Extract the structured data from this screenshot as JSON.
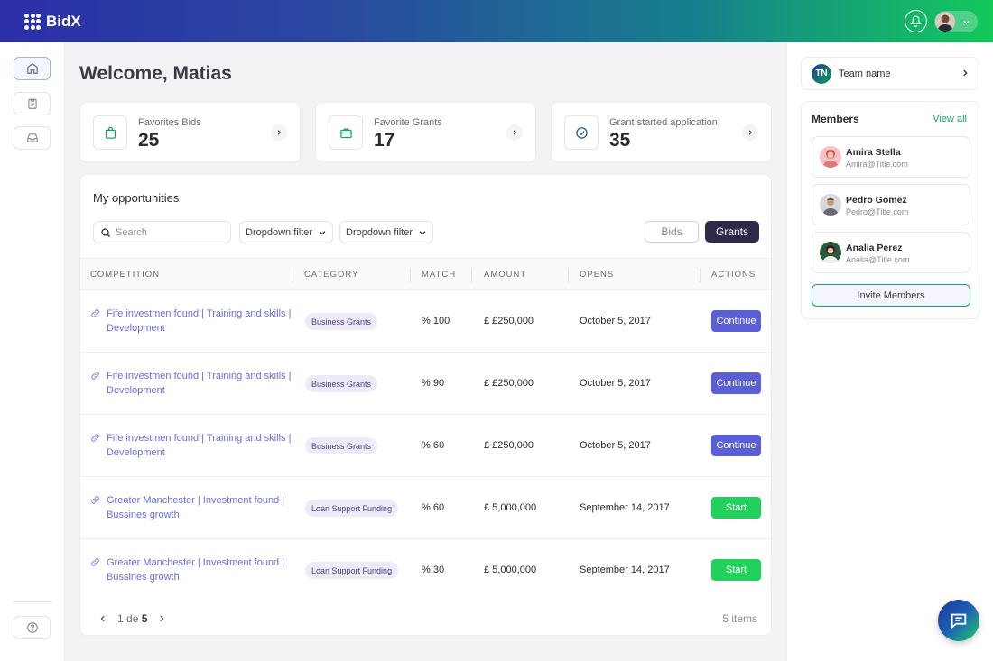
{
  "app": {
    "name": "BidX"
  },
  "welcome": "Welcome, Matias",
  "stats": [
    {
      "label": "Favorites Bids",
      "value": "25",
      "icon": "bag-icon"
    },
    {
      "label": "Favorite Grants",
      "value": "17",
      "icon": "briefcase-icon"
    },
    {
      "label": "Grant started application",
      "value": "35",
      "icon": "check-circle-icon"
    }
  ],
  "opportunities": {
    "title": "My opportunities",
    "search_placeholder": "Search",
    "filters": [
      "Dropdown filter",
      "Dropdown filter"
    ],
    "toggle": {
      "bids": "Bids",
      "grants": "Grants",
      "active": "Grants"
    },
    "columns": [
      "COMPETITION",
      "CATEGORY",
      "MATCH",
      "AMOUNT",
      "OPENS",
      "ACTIONS"
    ],
    "rows": [
      {
        "competition": "Fife investmen found | Training and skills | Development",
        "category": "Business Grants",
        "match": "% 100",
        "amount": "£ £250,000",
        "opens": "October 5, 2017",
        "action": "Continue"
      },
      {
        "competition": "Fife investmen found | Training and skills | Development",
        "category": "Business Grants",
        "match": "% 90",
        "amount": "£ £250,000",
        "opens": "October 5, 2017",
        "action": "Continue"
      },
      {
        "competition": "Fife investmen found | Training and skills | Development",
        "category": "Business Grants",
        "match": "% 60",
        "amount": "£ £250,000",
        "opens": "October 5, 2017",
        "action": "Continue"
      },
      {
        "competition": "Greater Manchester | Investment found | Bussines growth",
        "category": "Loan Support Funding",
        "match": "% 60",
        "amount": "£ 5,000,000",
        "opens": "September 14, 2017",
        "action": "Start"
      },
      {
        "competition": "Greater Manchester | Investment found | Bussines growth",
        "category": "Loan Support Funding",
        "match": "% 30",
        "amount": "£ 5,000,000",
        "opens": "September 14, 2017",
        "action": "Start"
      }
    ],
    "pagination": {
      "current": "1",
      "separator": "de",
      "total": "5"
    },
    "items_count": "5 items"
  },
  "team": {
    "initials": "TN",
    "name": "Team name"
  },
  "members": {
    "title": "Members",
    "view_all": "View all",
    "list": [
      {
        "name": "Amira Stella",
        "email": "Amira@Title.com"
      },
      {
        "name": "Pedro Gomez",
        "email": "Pedro@Title.com"
      },
      {
        "name": "Analia Perez",
        "email": "Analia@Title.com"
      }
    ],
    "invite_label": "Invite Members"
  },
  "colors": {
    "accent": "#5a5fd6",
    "start": "#22d15c",
    "brand_green": "#1aa06a",
    "link": "#6a6fd8"
  }
}
